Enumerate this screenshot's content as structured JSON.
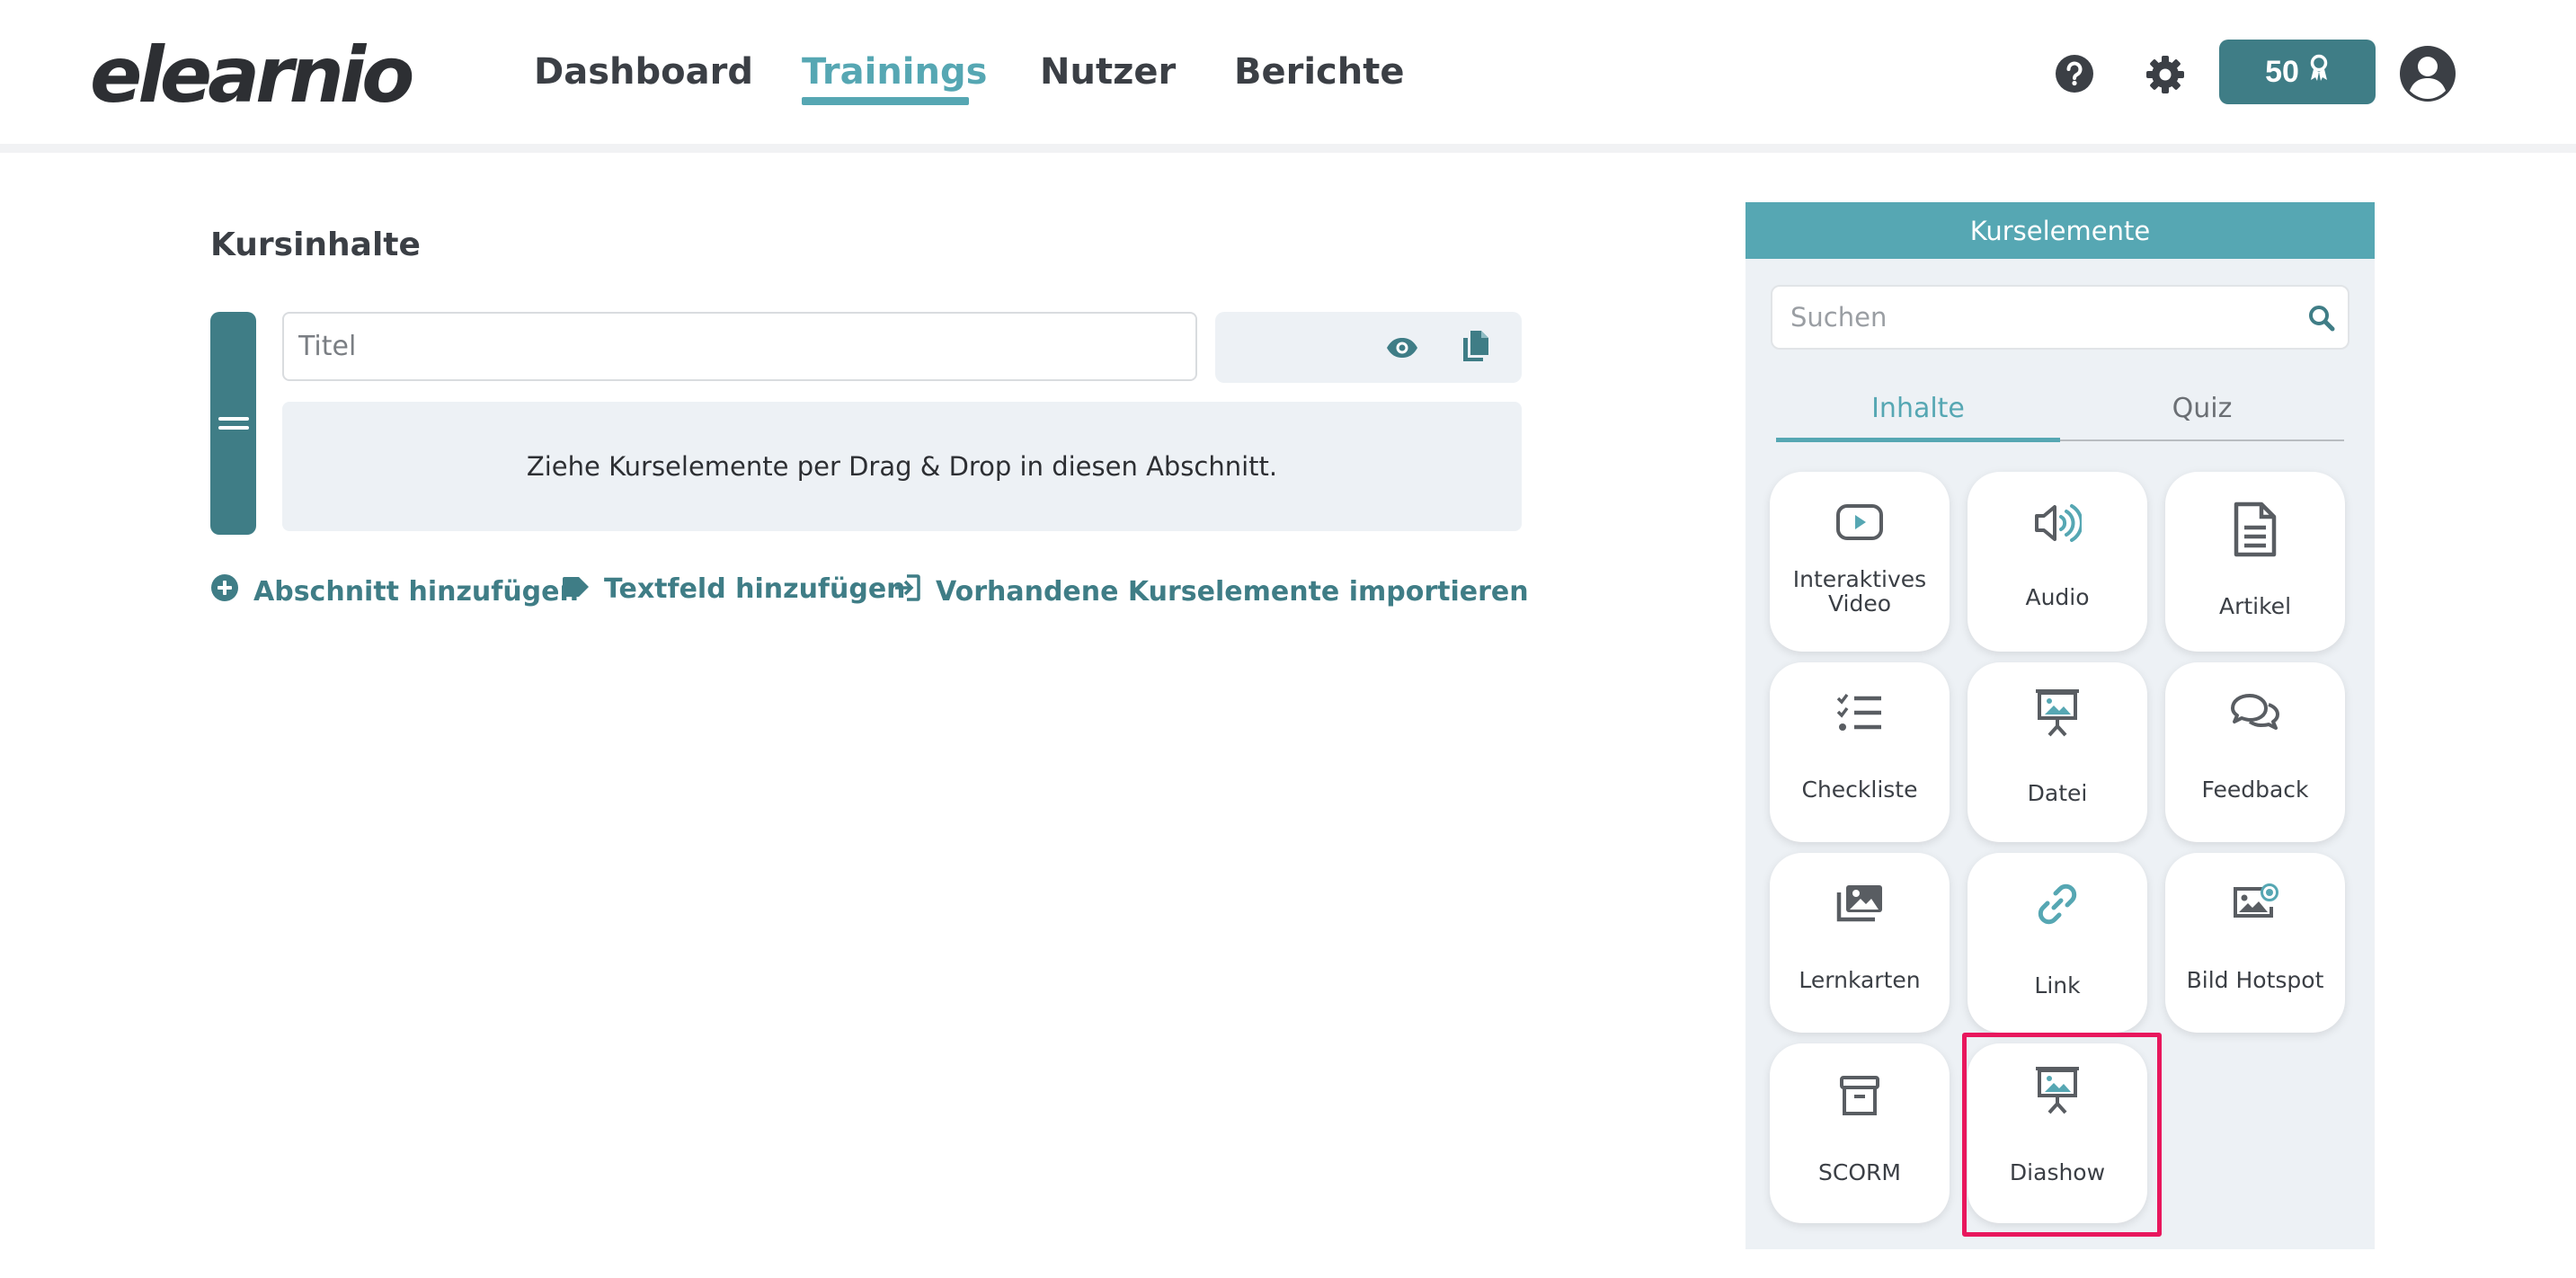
{
  "header": {
    "logo": "elearnio",
    "nav": [
      "Dashboard",
      "Trainings",
      "Nutzer",
      "Berichte"
    ],
    "active_nav": "Trainings",
    "credits": "50",
    "icons": [
      "help-icon",
      "settings-icon",
      "award-icon",
      "user-avatar-icon"
    ]
  },
  "main": {
    "title": "Kursinhalte",
    "section": {
      "title_placeholder": "Titel",
      "drop_hint": "Ziehe Kurselemente per Drag & Drop in diesen Abschnitt."
    },
    "actions": [
      {
        "label": "Abschnitt hinzufügen",
        "icon": "plus-circle-icon"
      },
      {
        "label": "Textfeld hinzufügen",
        "icon": "tag-icon"
      },
      {
        "label": "Vorhandene Kurselemente importieren",
        "icon": "import-icon"
      }
    ]
  },
  "panel": {
    "title": "Kurselemente",
    "search_placeholder": "Suchen",
    "tabs": [
      "Inhalte",
      "Quiz"
    ],
    "active_tab": "Inhalte",
    "elements": [
      {
        "label": "Interaktives Video",
        "icon": "video-play-icon"
      },
      {
        "label": "Audio",
        "icon": "audio-icon"
      },
      {
        "label": "Artikel",
        "icon": "document-icon"
      },
      {
        "label": "Checkliste",
        "icon": "checklist-icon"
      },
      {
        "label": "Datei",
        "icon": "presentation-icon"
      },
      {
        "label": "Feedback",
        "icon": "chat-bubbles-icon"
      },
      {
        "label": "Lernkarten",
        "icon": "images-icon"
      },
      {
        "label": "Link",
        "icon": "link-icon"
      },
      {
        "label": "Bild Hotspot",
        "icon": "image-hotspot-icon"
      },
      {
        "label": "SCORM",
        "icon": "archive-box-icon"
      },
      {
        "label": "Diashow",
        "icon": "presentation-icon"
      }
    ],
    "highlighted_element": "Diashow"
  },
  "colors": {
    "accent": "#56a7b3",
    "primary_dark": "#3f7d86",
    "highlight": "#e8175d",
    "panel_bg": "#edf1f5",
    "text": "#3b3f45"
  }
}
